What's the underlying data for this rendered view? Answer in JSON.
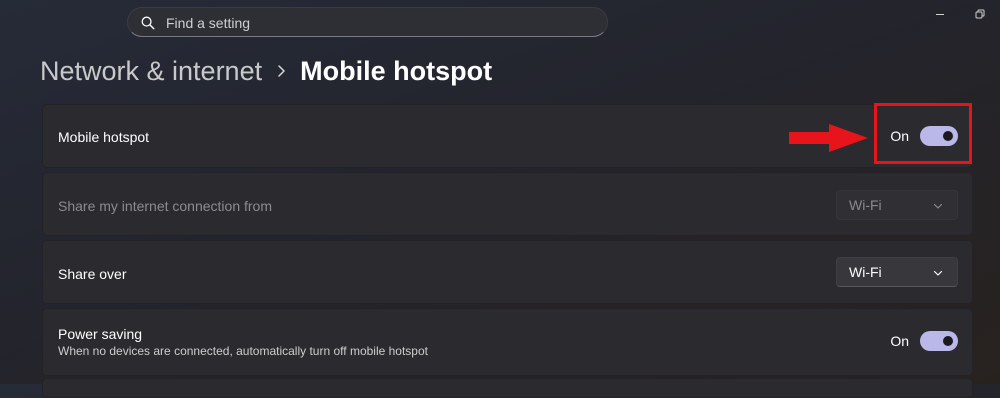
{
  "search": {
    "placeholder": "Find a setting",
    "icon": "search-icon"
  },
  "window_controls": {
    "icons": [
      "minimize-icon",
      "restore-icon"
    ]
  },
  "breadcrumb": {
    "parent": "Network & internet",
    "separator_icon": "chevron-right-icon",
    "current": "Mobile hotspot"
  },
  "settings": {
    "mobile_hotspot": {
      "label": "Mobile hotspot",
      "state_label": "On",
      "enabled": true
    },
    "share_from": {
      "label": "Share my internet connection from",
      "value": "Wi-Fi",
      "disabled": true
    },
    "share_over": {
      "label": "Share over",
      "value": "Wi-Fi"
    },
    "power_saving": {
      "label": "Power saving",
      "description": "When no devices are connected, automatically turn off mobile hotspot",
      "state_label": "On",
      "enabled": true
    }
  },
  "annotation": {
    "color": "#e8141b",
    "arrow_icon": "arrow-right-icon"
  },
  "colors": {
    "toggle_on": "#b9b8e9",
    "card_background": "#2b2b2f"
  }
}
